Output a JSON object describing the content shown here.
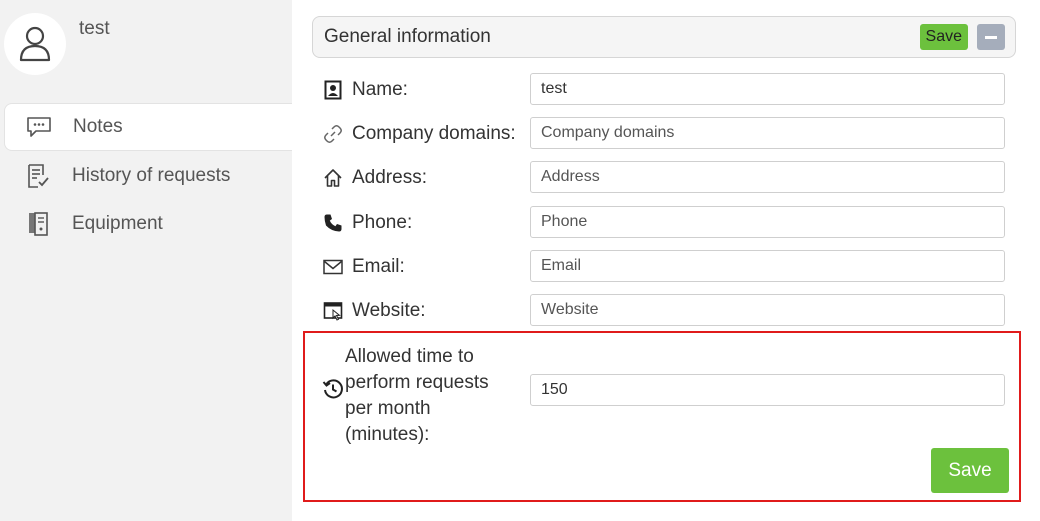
{
  "profile": {
    "username": "test"
  },
  "sidebar": {
    "items": [
      {
        "label": "Notes",
        "icon": "notes-icon",
        "active": true
      },
      {
        "label": "History of requests",
        "icon": "history-icon",
        "active": false
      },
      {
        "label": "Equipment",
        "icon": "equipment-icon",
        "active": false
      }
    ]
  },
  "panel": {
    "title": "General information",
    "save_label": "Save"
  },
  "fields": {
    "name": {
      "label": "Name:",
      "value": "test",
      "placeholder": ""
    },
    "company_domains": {
      "label": "Company domains:",
      "value": "",
      "placeholder": "Company domains"
    },
    "address": {
      "label": "Address:",
      "value": "",
      "placeholder": "Address"
    },
    "phone": {
      "label": "Phone:",
      "value": "",
      "placeholder": "Phone"
    },
    "email": {
      "label": "Email:",
      "value": "",
      "placeholder": "Email"
    },
    "website": {
      "label": "Website:",
      "value": "",
      "placeholder": "Website"
    }
  },
  "allowed_time": {
    "label": "Allowed time to perform requests per month (minutes):",
    "value": "150",
    "save_label": "Save"
  },
  "colors": {
    "accent_green": "#6cc13d",
    "highlight_red": "#e01b1b",
    "collapse_gray": "#a5adbb"
  }
}
